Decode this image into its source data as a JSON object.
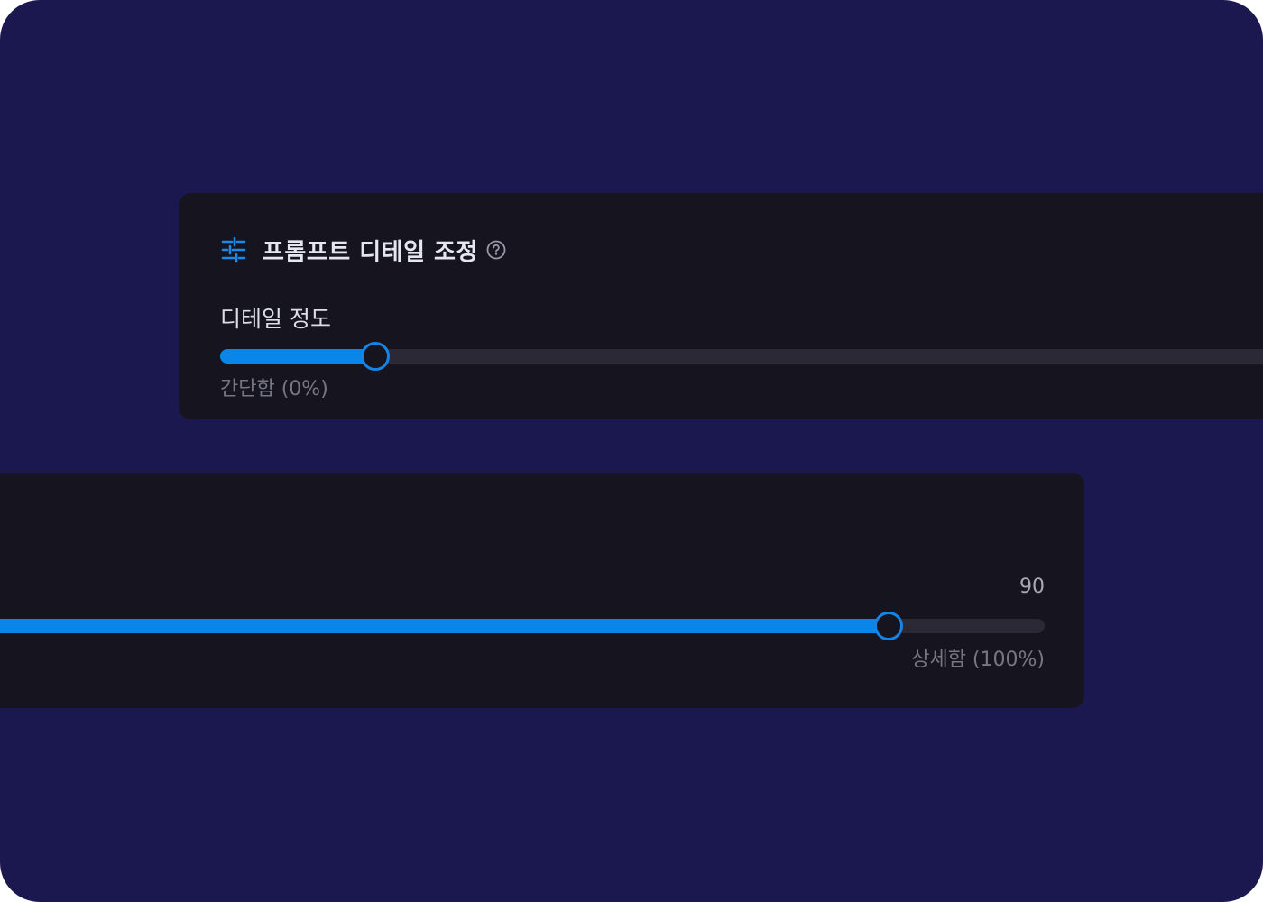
{
  "panel": {
    "title": "프롬프트 디테일 조정",
    "title_icon": "tune-sliders-icon",
    "help_icon": "help-circle-icon"
  },
  "slider": {
    "label": "디테일 정도",
    "value": 90,
    "value_text": "90",
    "min_label": "간단함 (0%)",
    "max_label": "상세함 (100%)",
    "min": 0,
    "max": 100
  },
  "colors": {
    "background": "#1b1850",
    "card": "#16151f",
    "accent": "#0a86e8",
    "track": "#2a2935",
    "text_primary": "#e6e6ee",
    "text_muted": "#777684"
  }
}
